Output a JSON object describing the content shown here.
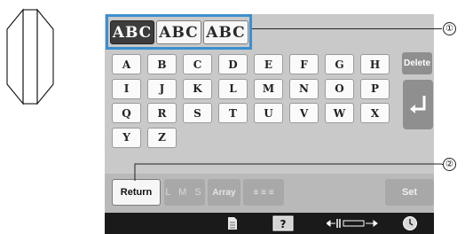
{
  "font_tabs": [
    {
      "label": "ABC",
      "active": true
    },
    {
      "label": "ABC",
      "active": false
    },
    {
      "label": "ABC",
      "active": false
    }
  ],
  "keys": [
    [
      "A",
      "B",
      "C",
      "D",
      "E",
      "F",
      "G",
      "H"
    ],
    [
      "I",
      "J",
      "K",
      "L",
      "M",
      "N",
      "O",
      "P"
    ],
    [
      "Q",
      "R",
      "S",
      "T",
      "U",
      "V",
      "W",
      "X"
    ],
    [
      "Y",
      "Z"
    ]
  ],
  "buttons": {
    "delete": "Delete",
    "return": "Return",
    "lms": "L M S",
    "array": "Array",
    "align": "≡ ≡ ≡",
    "set": "Set"
  },
  "callouts": {
    "one": "①",
    "two": "②"
  },
  "icons": {
    "logo": "hexagon-outline-icon",
    "enter": "enter-arrow-icon",
    "page": "page-icon",
    "help": "help-icon",
    "spacing": "spacing-icon",
    "clock": "clock-icon"
  },
  "colors": {
    "panel": "#c9c9c9",
    "highlight": "#3b8fd0",
    "status_bar": "#1a1a1a"
  }
}
